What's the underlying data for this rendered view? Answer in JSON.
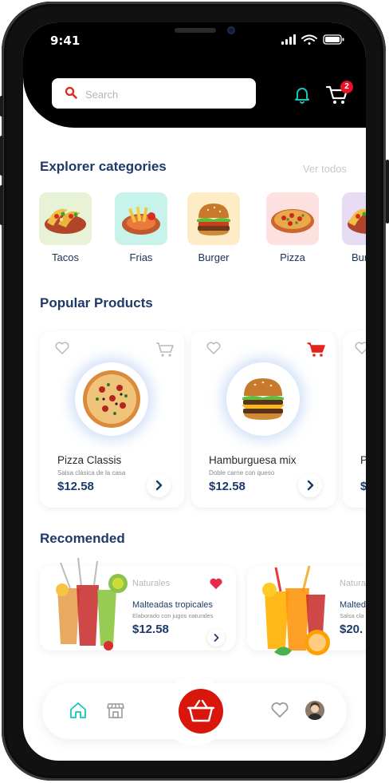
{
  "status_bar": {
    "time": "9:41"
  },
  "header": {
    "search_placeholder": "Search",
    "cart_count": "2"
  },
  "categories_section": {
    "title": "Explorer categories",
    "see_all": "Ver todos",
    "items": [
      {
        "label": "Tacos",
        "bg": "#e7f2d6"
      },
      {
        "label": "Frias",
        "bg": "#c8f3ea"
      },
      {
        "label": "Burger",
        "bg": "#fdecc6"
      },
      {
        "label": "Pizza",
        "bg": "#fde0e0"
      },
      {
        "label": "Bur",
        "bg": "#e8dcf5"
      }
    ]
  },
  "popular_section": {
    "title": "Popular Products",
    "products": [
      {
        "name": "Pizza Classis",
        "desc": "Salsa clásica de la casa",
        "price": "$12.58"
      },
      {
        "name": "Hamburguesa mix",
        "desc": "Doble carne con queso",
        "price": "$12.58"
      },
      {
        "name": "P",
        "desc": "",
        "price": "$"
      }
    ]
  },
  "recommended_section": {
    "title": "Recomended",
    "items": [
      {
        "tag": "Naturales",
        "name": "Malteadas tropicales",
        "desc": "Elaborado con jugos naturales",
        "price": "$12.58"
      },
      {
        "tag": "Naturale",
        "name": "Malted",
        "desc": "Salsa cla",
        "price": "$20."
      }
    ]
  },
  "colors": {
    "navy": "#1e3a6a",
    "teal_icon": "#16c7b7",
    "accent_red": "#d9160c",
    "badge_red": "#e8122b"
  },
  "bottom_nav": {
    "icons": [
      "home-icon",
      "store-icon",
      "basket-icon",
      "heart-icon",
      "avatar"
    ]
  }
}
